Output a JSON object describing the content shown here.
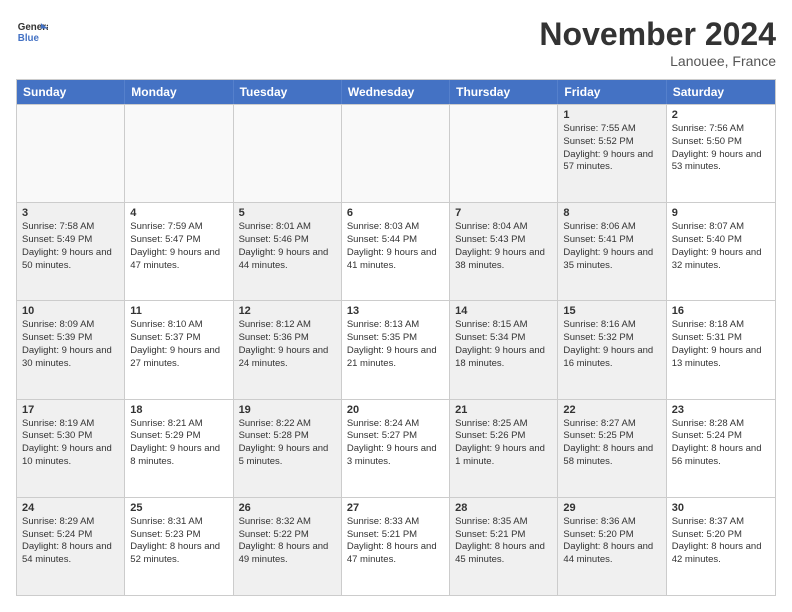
{
  "logo": {
    "line1": "General",
    "line2": "Blue"
  },
  "title": "November 2024",
  "location": "Lanouee, France",
  "header_days": [
    "Sunday",
    "Monday",
    "Tuesday",
    "Wednesday",
    "Thursday",
    "Friday",
    "Saturday"
  ],
  "rows": [
    [
      {
        "day": "",
        "text": "",
        "empty": true
      },
      {
        "day": "",
        "text": "",
        "empty": true
      },
      {
        "day": "",
        "text": "",
        "empty": true
      },
      {
        "day": "",
        "text": "",
        "empty": true
      },
      {
        "day": "",
        "text": "",
        "empty": true
      },
      {
        "day": "1",
        "text": "Sunrise: 7:55 AM\nSunset: 5:52 PM\nDaylight: 9 hours and 57 minutes.",
        "shaded": true
      },
      {
        "day": "2",
        "text": "Sunrise: 7:56 AM\nSunset: 5:50 PM\nDaylight: 9 hours and 53 minutes.",
        "shaded": false
      }
    ],
    [
      {
        "day": "3",
        "text": "Sunrise: 7:58 AM\nSunset: 5:49 PM\nDaylight: 9 hours and 50 minutes.",
        "shaded": true
      },
      {
        "day": "4",
        "text": "Sunrise: 7:59 AM\nSunset: 5:47 PM\nDaylight: 9 hours and 47 minutes.",
        "shaded": false
      },
      {
        "day": "5",
        "text": "Sunrise: 8:01 AM\nSunset: 5:46 PM\nDaylight: 9 hours and 44 minutes.",
        "shaded": true
      },
      {
        "day": "6",
        "text": "Sunrise: 8:03 AM\nSunset: 5:44 PM\nDaylight: 9 hours and 41 minutes.",
        "shaded": false
      },
      {
        "day": "7",
        "text": "Sunrise: 8:04 AM\nSunset: 5:43 PM\nDaylight: 9 hours and 38 minutes.",
        "shaded": true
      },
      {
        "day": "8",
        "text": "Sunrise: 8:06 AM\nSunset: 5:41 PM\nDaylight: 9 hours and 35 minutes.",
        "shaded": true
      },
      {
        "day": "9",
        "text": "Sunrise: 8:07 AM\nSunset: 5:40 PM\nDaylight: 9 hours and 32 minutes.",
        "shaded": false
      }
    ],
    [
      {
        "day": "10",
        "text": "Sunrise: 8:09 AM\nSunset: 5:39 PM\nDaylight: 9 hours and 30 minutes.",
        "shaded": true
      },
      {
        "day": "11",
        "text": "Sunrise: 8:10 AM\nSunset: 5:37 PM\nDaylight: 9 hours and 27 minutes.",
        "shaded": false
      },
      {
        "day": "12",
        "text": "Sunrise: 8:12 AM\nSunset: 5:36 PM\nDaylight: 9 hours and 24 minutes.",
        "shaded": true
      },
      {
        "day": "13",
        "text": "Sunrise: 8:13 AM\nSunset: 5:35 PM\nDaylight: 9 hours and 21 minutes.",
        "shaded": false
      },
      {
        "day": "14",
        "text": "Sunrise: 8:15 AM\nSunset: 5:34 PM\nDaylight: 9 hours and 18 minutes.",
        "shaded": true
      },
      {
        "day": "15",
        "text": "Sunrise: 8:16 AM\nSunset: 5:32 PM\nDaylight: 9 hours and 16 minutes.",
        "shaded": true
      },
      {
        "day": "16",
        "text": "Sunrise: 8:18 AM\nSunset: 5:31 PM\nDaylight: 9 hours and 13 minutes.",
        "shaded": false
      }
    ],
    [
      {
        "day": "17",
        "text": "Sunrise: 8:19 AM\nSunset: 5:30 PM\nDaylight: 9 hours and 10 minutes.",
        "shaded": true
      },
      {
        "day": "18",
        "text": "Sunrise: 8:21 AM\nSunset: 5:29 PM\nDaylight: 9 hours and 8 minutes.",
        "shaded": false
      },
      {
        "day": "19",
        "text": "Sunrise: 8:22 AM\nSunset: 5:28 PM\nDaylight: 9 hours and 5 minutes.",
        "shaded": true
      },
      {
        "day": "20",
        "text": "Sunrise: 8:24 AM\nSunset: 5:27 PM\nDaylight: 9 hours and 3 minutes.",
        "shaded": false
      },
      {
        "day": "21",
        "text": "Sunrise: 8:25 AM\nSunset: 5:26 PM\nDaylight: 9 hours and 1 minute.",
        "shaded": true
      },
      {
        "day": "22",
        "text": "Sunrise: 8:27 AM\nSunset: 5:25 PM\nDaylight: 8 hours and 58 minutes.",
        "shaded": true
      },
      {
        "day": "23",
        "text": "Sunrise: 8:28 AM\nSunset: 5:24 PM\nDaylight: 8 hours and 56 minutes.",
        "shaded": false
      }
    ],
    [
      {
        "day": "24",
        "text": "Sunrise: 8:29 AM\nSunset: 5:24 PM\nDaylight: 8 hours and 54 minutes.",
        "shaded": true
      },
      {
        "day": "25",
        "text": "Sunrise: 8:31 AM\nSunset: 5:23 PM\nDaylight: 8 hours and 52 minutes.",
        "shaded": false
      },
      {
        "day": "26",
        "text": "Sunrise: 8:32 AM\nSunset: 5:22 PM\nDaylight: 8 hours and 49 minutes.",
        "shaded": true
      },
      {
        "day": "27",
        "text": "Sunrise: 8:33 AM\nSunset: 5:21 PM\nDaylight: 8 hours and 47 minutes.",
        "shaded": false
      },
      {
        "day": "28",
        "text": "Sunrise: 8:35 AM\nSunset: 5:21 PM\nDaylight: 8 hours and 45 minutes.",
        "shaded": true
      },
      {
        "day": "29",
        "text": "Sunrise: 8:36 AM\nSunset: 5:20 PM\nDaylight: 8 hours and 44 minutes.",
        "shaded": true
      },
      {
        "day": "30",
        "text": "Sunrise: 8:37 AM\nSunset: 5:20 PM\nDaylight: 8 hours and 42 minutes.",
        "shaded": false
      }
    ]
  ]
}
